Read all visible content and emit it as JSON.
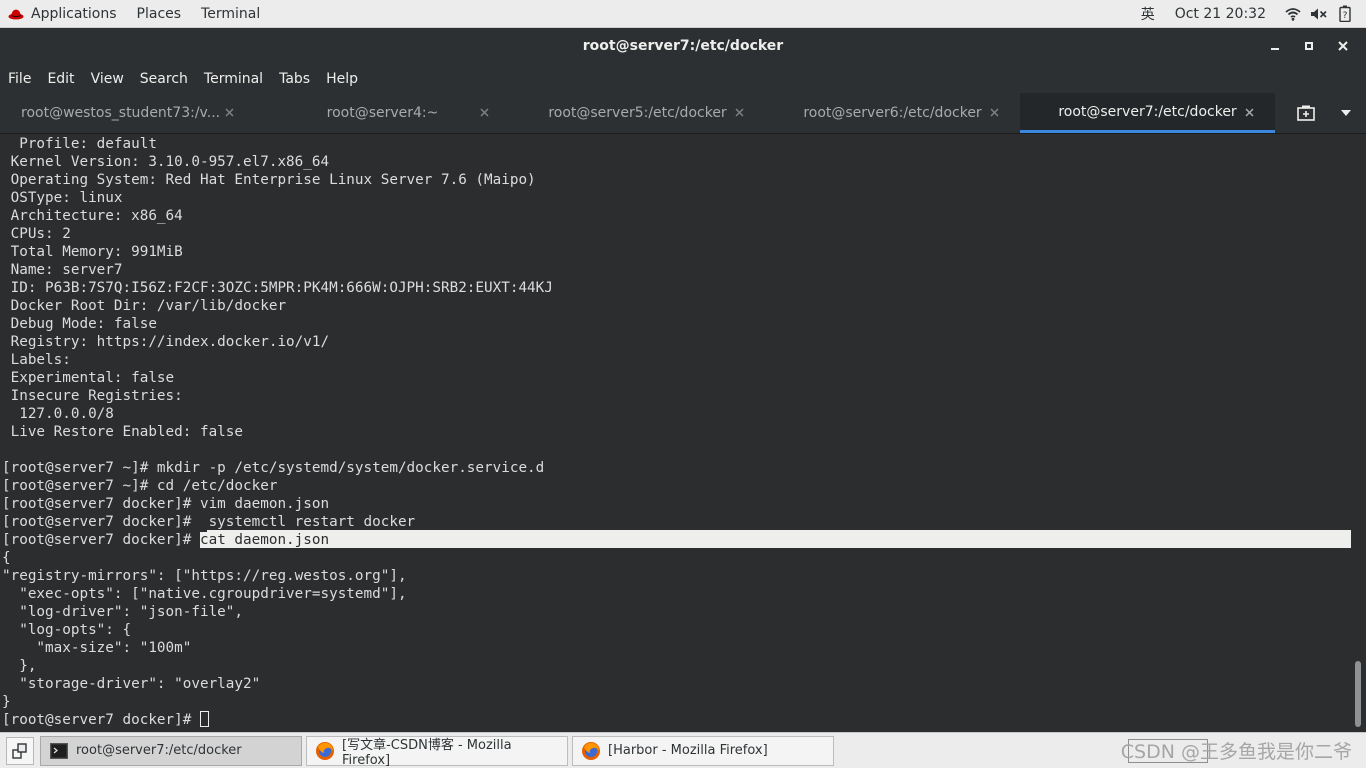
{
  "top_panel": {
    "applications": "Applications",
    "places": "Places",
    "terminal": "Terminal",
    "ime": "英",
    "clock": "Oct 21  20:32",
    "icons": [
      "redhat-icon",
      "wifi-icon",
      "volume-icon",
      "battery-icon"
    ]
  },
  "window": {
    "title": "root@server7:/etc/docker",
    "controls": [
      "minimize-icon",
      "maximize-icon",
      "close-icon"
    ]
  },
  "menu": {
    "items": [
      "File",
      "Edit",
      "View",
      "Search",
      "Terminal",
      "Tabs",
      "Help"
    ]
  },
  "tabs": [
    {
      "label": "root@westos_student73:/v..."
    },
    {
      "label": "root@server4:~"
    },
    {
      "label": "root@server5:/etc/docker"
    },
    {
      "label": "root@server6:/etc/docker"
    },
    {
      "label": "root@server7:/etc/docker",
      "active": true
    }
  ],
  "terminal": {
    "lines": [
      "  Profile: default",
      " Kernel Version: 3.10.0-957.el7.x86_64",
      " Operating System: Red Hat Enterprise Linux Server 7.6 (Maipo)",
      " OSType: linux",
      " Architecture: x86_64",
      " CPUs: 2",
      " Total Memory: 991MiB",
      " Name: server7",
      " ID: P63B:7S7Q:I56Z:F2CF:3OZC:5MPR:PK4M:666W:OJPH:SRB2:EUXT:44KJ",
      " Docker Root Dir: /var/lib/docker",
      " Debug Mode: false",
      " Registry: https://index.docker.io/v1/",
      " Labels:",
      " Experimental: false",
      " Insecure Registries:",
      "  127.0.0.0/8",
      " Live Restore Enabled: false",
      "",
      "[root@server7 ~]# mkdir -p /etc/systemd/system/docker.service.d",
      "[root@server7 ~]# cd /etc/docker",
      "[root@server7 docker]# vim daemon.json",
      "[root@server7 docker]#  systemctl restart docker",
      "[root@server7 docker]# ",
      "{",
      "\"registry-mirrors\": [\"https://reg.westos.org\"],",
      "  \"exec-opts\": [\"native.cgroupdriver=systemd\"],",
      "  \"log-driver\": \"json-file\",",
      "  \"log-opts\": {",
      "    \"max-size\": \"100m\"",
      "  },",
      "  \"storage-driver\": \"overlay2\"",
      "}",
      "[root@server7 docker]# "
    ],
    "highlighted_command": "cat daemon.json"
  },
  "taskbar": {
    "tasks": [
      {
        "label": "root@server7:/etc/docker",
        "icon": "terminal-icon",
        "active": true
      },
      {
        "label": "[写文章-CSDN博客 - Mozilla Firefox]",
        "icon": "firefox-icon"
      },
      {
        "label": "[Harbor - Mozilla Firefox]",
        "icon": "firefox-icon"
      }
    ],
    "watermark": "CSDN @王多鱼我是你二爷"
  }
}
